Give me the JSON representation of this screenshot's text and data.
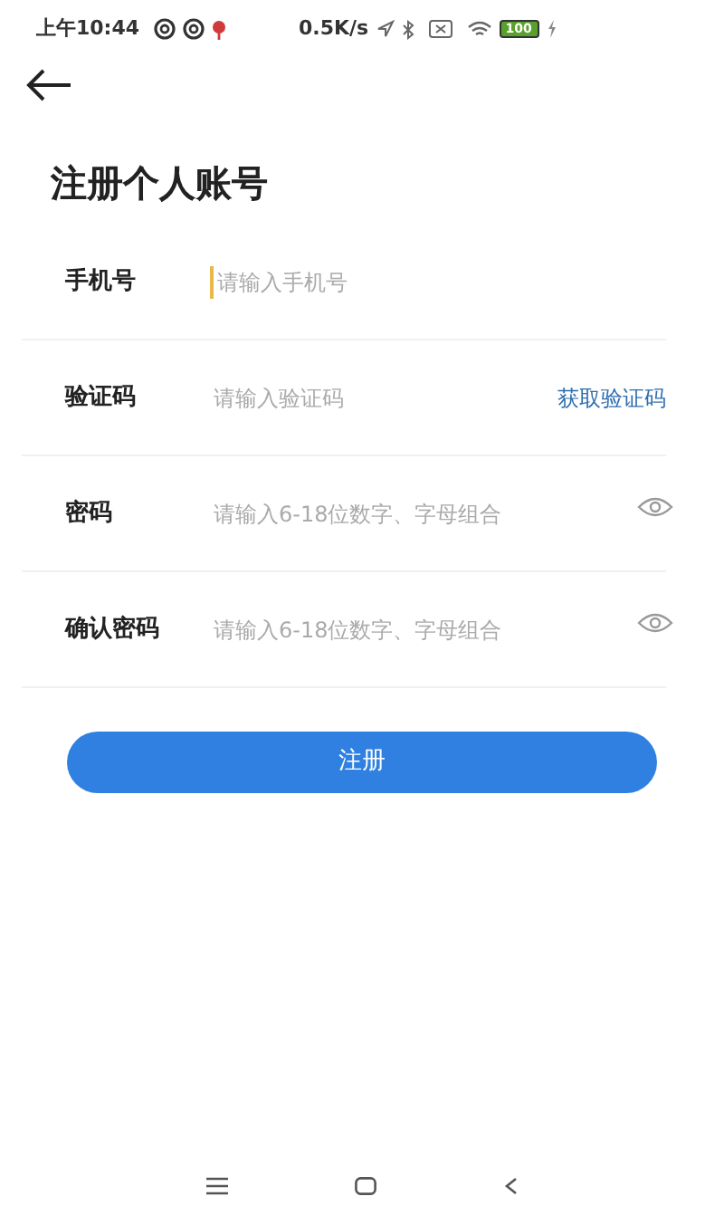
{
  "status_bar": {
    "time": "上午10:44",
    "speed": "0.5K/s",
    "battery": "100"
  },
  "title": "注册个人账号",
  "fields": [
    {
      "kind": "phone",
      "label": "手机号",
      "placeholder": "请输入手机号",
      "focused": true
    },
    {
      "kind": "code",
      "label": "验证码",
      "placeholder": "请输入验证码",
      "action": "获取验证码",
      "focused": false
    },
    {
      "kind": "password",
      "label": "密码",
      "placeholder": "请输入6-18位数字、字母组合",
      "focused": false
    },
    {
      "kind": "password",
      "label": "确认密码",
      "placeholder": "请输入6-18位数字、字母组合",
      "focused": false
    }
  ],
  "submit": "注册"
}
